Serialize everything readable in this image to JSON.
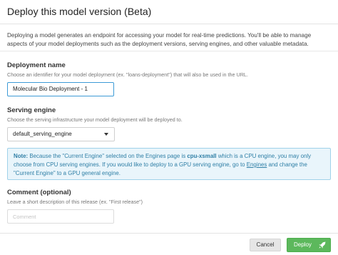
{
  "dialog": {
    "title": "Deploy this model version (Beta)",
    "intro": "Deploying a model generates an endpoint for accessing your model for real-time predictions. You'll be able to manage aspects of your model deployments such as the deployment versions, serving engines, and other valuable metadata."
  },
  "deployment_name": {
    "label": "Deployment name",
    "help": "Choose an identifier for your model deployment (ex. \"loans-deployment\") that will also be used in the URL.",
    "value": "Molecular Bio Deployment - 1"
  },
  "serving_engine": {
    "label": "Serving engine",
    "help": "Choose the serving infrastructure your model deployment will be deployed to.",
    "selected": "default_serving_engine"
  },
  "note": {
    "prefix": "Note:",
    "text_1": "Because the \"Current Engine\" selected on the Engines page is",
    "engine": "cpu-xsmall",
    "text_2": "which is a CPU engine, you may only choose from CPU serving engines. If you would like to deploy to a GPU serving engine, go to",
    "link": "Engines",
    "text_3": "and change the \"Current Engine\" to a GPU general engine."
  },
  "comment": {
    "label": "Comment (optional)",
    "help": "Leave a short description of this release (ex. \"First release\")",
    "placeholder": "Comment"
  },
  "footer": {
    "cancel_label": "Cancel",
    "deploy_label": "Deploy",
    "deploy_icon": "rocket-icon"
  },
  "colors": {
    "deploy_button": "#5cb85c",
    "note_background": "#e9f5fb",
    "note_text": "#2f7fa6",
    "focus_border": "#3d9bd6"
  }
}
